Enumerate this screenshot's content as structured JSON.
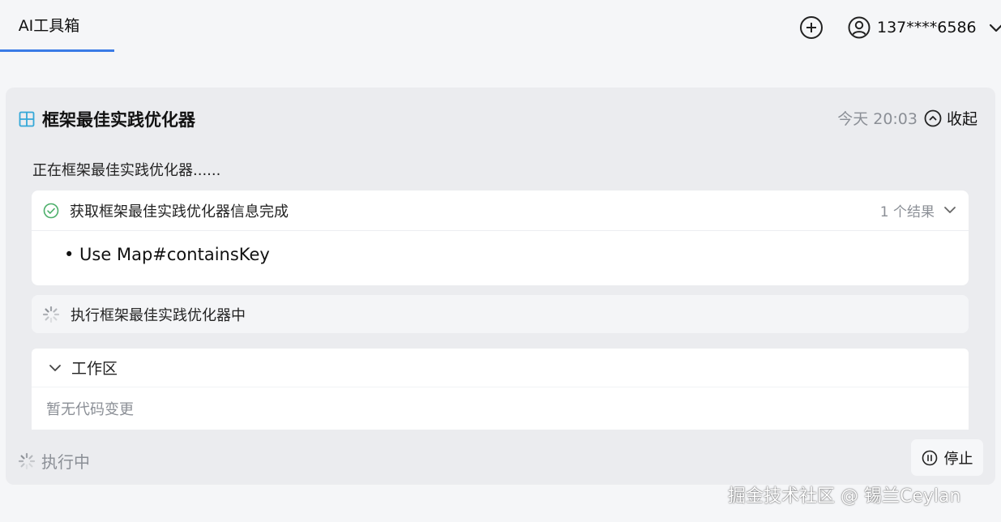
{
  "header": {
    "tab_label": "AI工具箱",
    "user_name": "137****6586",
    "icons": {
      "add": "add-circle-icon",
      "user": "user-circle-icon",
      "dropdown": "chevron-down-icon"
    }
  },
  "card": {
    "title": "框架最佳实践优化器",
    "time": "今天 20:03",
    "collapse_label": "收起",
    "status_text": "正在框架最佳实践优化器......",
    "result": {
      "title": "获取框架最佳实践优化器信息完成",
      "count": "1 个结果",
      "items": [
        "• Use Map#containsKey"
      ]
    },
    "executing_label": "执行框架最佳实践优化器中",
    "workspace": {
      "title": "工作区",
      "empty_text": "暂无代码变更"
    },
    "footer_status": "执行中",
    "stop_label": "停止"
  },
  "colors": {
    "accent": "#3a7be6",
    "icon_teal": "#34a8d8",
    "success": "#4caf6a",
    "muted": "#8b8f96"
  },
  "watermark": "掘金技术社区 @ 锡兰Ceylan"
}
